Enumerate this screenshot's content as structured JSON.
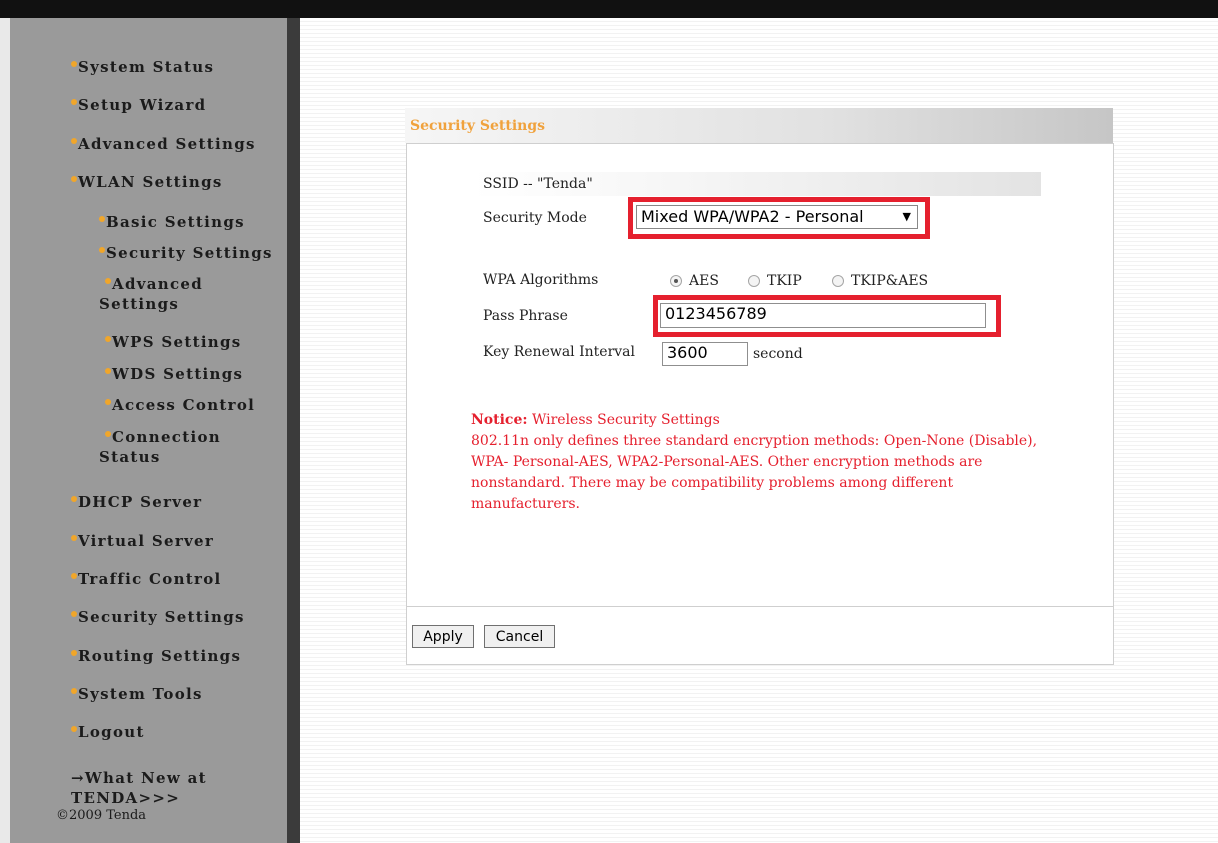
{
  "sidebar": {
    "items": [
      {
        "label": "System Status"
      },
      {
        "label": "Setup Wizard"
      },
      {
        "label": "Advanced Settings"
      },
      {
        "label": "WLAN Settings"
      },
      {
        "label": "Basic Settings"
      },
      {
        "label": "Security Settings"
      },
      {
        "label": "Advanced Settings"
      },
      {
        "label": "WPS Settings"
      },
      {
        "label": "WDS Settings"
      },
      {
        "label": "Access Control"
      },
      {
        "label": "Connection Status"
      },
      {
        "label": "DHCP Server"
      },
      {
        "label": "Virtual Server"
      },
      {
        "label": "Traffic Control"
      },
      {
        "label": "Security Settings"
      },
      {
        "label": "Routing Settings"
      },
      {
        "label": "System Tools"
      },
      {
        "label": "Logout"
      }
    ],
    "whats_new": "→What New at TENDA>>>",
    "copyright": "©2009 Tenda"
  },
  "panel": {
    "title": "Security Settings",
    "ssid_label": "SSID -- \"Tenda\"",
    "security_mode_label": "Security Mode",
    "security_mode_value": "Mixed WPA/WPA2 - Personal",
    "wpa_algorithms_label": "WPA Algorithms",
    "algorithms": [
      {
        "label": "AES",
        "checked": true
      },
      {
        "label": "TKIP",
        "checked": false
      },
      {
        "label": "TKIP&AES",
        "checked": false
      }
    ],
    "pass_phrase_label": "Pass Phrase",
    "pass_phrase_value": "0123456789",
    "key_renewal_label": "Key Renewal Interval",
    "key_renewal_value": "3600",
    "key_renewal_unit": "second",
    "notice_title": "Notice:",
    "notice_subtitle": " Wireless Security Settings",
    "notice_text": "802.11n only defines three standard encryption methods: Open-None (Disable), WPA- Personal-AES, WPA2-Personal-AES. Other encryption methods are nonstandard. There may be compatibility problems among different manufacturers.",
    "apply_label": "Apply",
    "cancel_label": "Cancel"
  },
  "colors": {
    "sidebar_bg": "#9a9a9a",
    "bullet": "#f0a62a",
    "header_title": "#f0a23d",
    "notice": "#e5202e",
    "highlight_box": "#e5202e"
  }
}
